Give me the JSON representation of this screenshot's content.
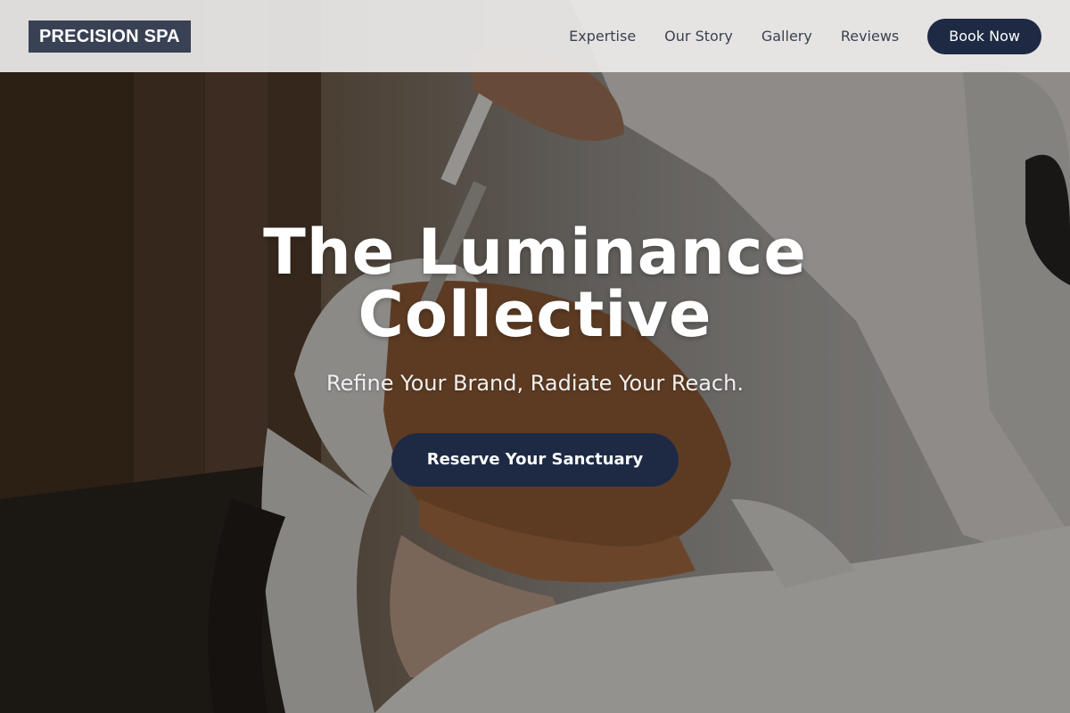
{
  "header": {
    "logo_text": "PRECISION SPA",
    "nav": [
      {
        "label": "Expertise"
      },
      {
        "label": "Our Story"
      },
      {
        "label": "Gallery"
      },
      {
        "label": "Reviews"
      }
    ],
    "book_label": "Book Now"
  },
  "hero": {
    "title_line1": "The Luminance",
    "title_line2": "Collective",
    "subtitle": "Refine Your Brand, Radiate Your Reach.",
    "cta_label": "Reserve Your Sanctuary",
    "image_subject": "facial treatment photo"
  },
  "colors": {
    "accent": "#1e2a44",
    "logo_bg": "#394254",
    "header_bg": "#ecebe9",
    "nav_text": "#3b4150"
  }
}
